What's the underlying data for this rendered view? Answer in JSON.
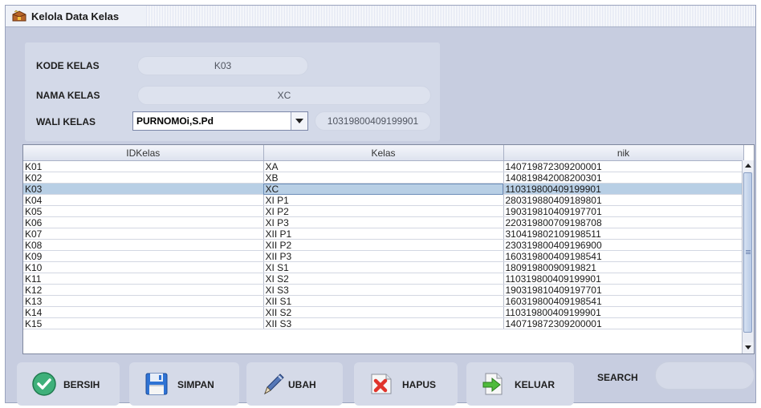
{
  "window": {
    "title": "Kelola Data Kelas"
  },
  "form": {
    "kode_label": "KODE KELAS",
    "kode_value": "K03",
    "nama_label": "NAMA KELAS",
    "nama_value": "XC",
    "wali_label": "WALI KELAS",
    "wali_selected": "PURNOMOi,S.Pd",
    "wali_nik": "10319800409199901"
  },
  "table": {
    "headers": [
      "IDKelas",
      "Kelas",
      "nik"
    ],
    "selected_index": 2,
    "rows": [
      [
        "K01",
        "XA",
        "140719872309200001"
      ],
      [
        "K02",
        "XB",
        "140819842008200301"
      ],
      [
        "K03",
        "XC",
        "110319800409199901"
      ],
      [
        "K04",
        "XI P1",
        "280319880409189801"
      ],
      [
        "K05",
        "XI P2",
        "190319810409197701"
      ],
      [
        "K06",
        "XI P3",
        "220319800709198708"
      ],
      [
        "K07",
        "XII P1",
        "310419802109198511"
      ],
      [
        "K08",
        "XII P2",
        "230319800409196900"
      ],
      [
        "K09",
        "XII P3",
        "160319800409198541"
      ],
      [
        "K10",
        "XI S1",
        "18091980090919821"
      ],
      [
        "K11",
        "XI S2",
        "110319800409199901"
      ],
      [
        "K12",
        "XI S3",
        "190319810409197701"
      ],
      [
        "K13",
        "XII S1",
        "160319800409198541"
      ],
      [
        "K14",
        "XII S2",
        "110319800409199901"
      ],
      [
        "K15",
        "XII S3",
        "140719872309200001"
      ]
    ]
  },
  "toolbar": {
    "bersih": "BERSIH",
    "simpan": "SIMPAN",
    "ubah": "UBAH",
    "hapus": "HAPUS",
    "keluar": "KELUAR"
  },
  "search": {
    "label": "SEARCH",
    "value": ""
  },
  "icons": {
    "window": "treasure-box-icon",
    "bersih": "check-circle-icon",
    "simpan": "floppy-disk-icon",
    "ubah": "pen-icon",
    "hapus": "delete-x-icon",
    "keluar": "exit-arrow-icon"
  }
}
